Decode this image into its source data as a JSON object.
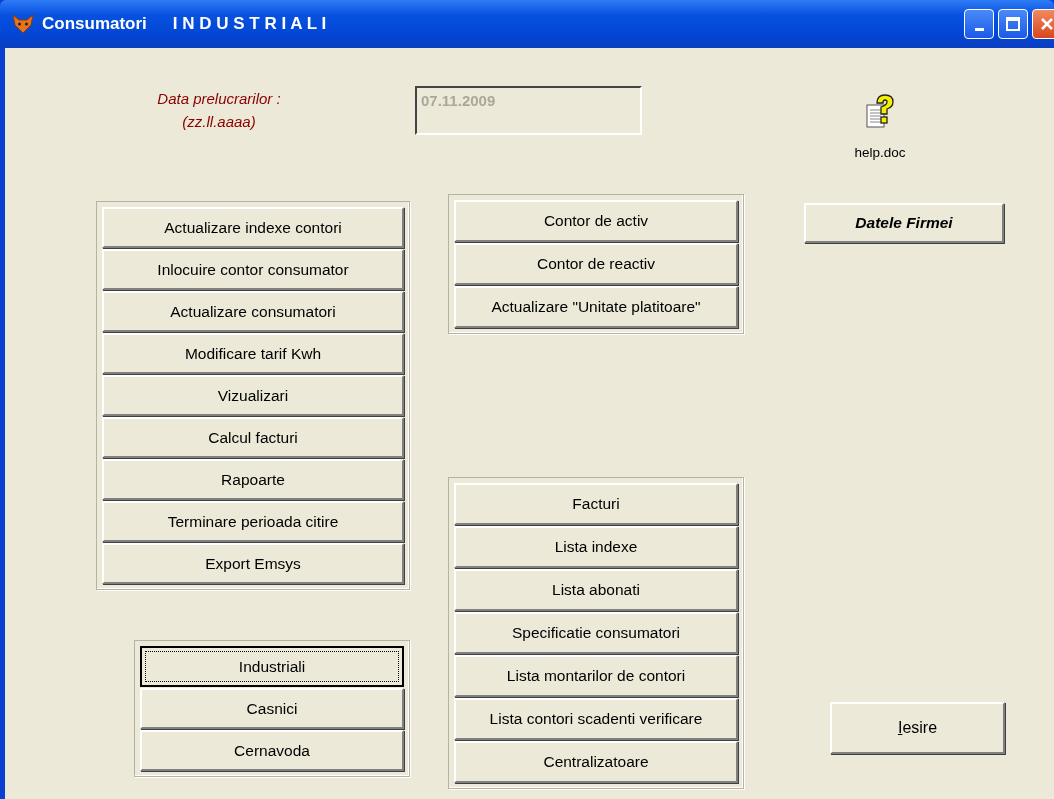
{
  "window": {
    "title": "Consumatori",
    "subtitle": "I N D U S T R I A L I"
  },
  "date_label": {
    "line_1": "Data prelucrarilor :",
    "line_2": "(zz.ll.aaaa)"
  },
  "date_field": {
    "value": "07.11.2009",
    "disabled": true
  },
  "help_file": {
    "label": "help.doc"
  },
  "company_button": {
    "label": "Datele Firmei"
  },
  "main_actions": [
    "Actualizare indexe contori",
    "Inlocuire contor consumator",
    "Actualizare consumatori",
    "Modificare tarif Kwh",
    "Vizualizari",
    "Calcul facturi",
    "Rapoarte",
    "Terminare perioada citire",
    "Export Emsys"
  ],
  "meter_actions": [
    "Contor de activ",
    "Contor de reactiv",
    "Actualizare \"Unitate platitoare\""
  ],
  "reports": [
    "Facturi",
    "Lista indexe",
    "Lista abonati",
    "Specificatie consumatori",
    "Lista montarilor de contori",
    "Lista contori scadenti verificare",
    "Centralizatoare"
  ],
  "consumer_types": [
    {
      "label": "Industriali",
      "selected": true
    },
    {
      "label": "Casnici",
      "selected": false
    },
    {
      "label": "Cernavoda",
      "selected": false
    }
  ],
  "exit_button": {
    "label": "Iesire",
    "first_letter_underlined": true
  }
}
